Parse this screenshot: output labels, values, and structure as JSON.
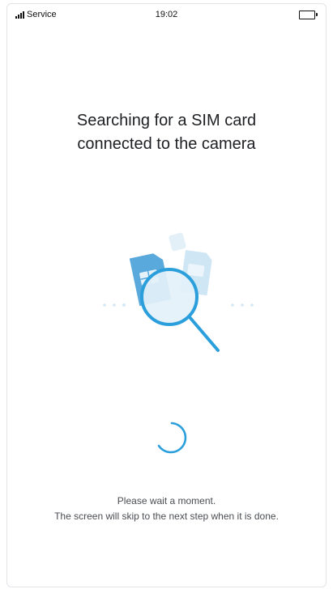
{
  "status_bar": {
    "carrier": "Service",
    "time": "19:02",
    "battery_icon": "battery-icon",
    "signal_icon": "signal-icon"
  },
  "main": {
    "title_line1": "Searching for a SIM card",
    "title_line2": "connected to the camera",
    "illustration_icon": "magnifier-over-sim-cards-icon",
    "spinner_icon": "loading-spinner-icon",
    "wait_message": "Please wait a moment.",
    "skip_message": "The screen will skip to the next step when it is done."
  },
  "colors": {
    "accent": "#2a9fdc",
    "accent_light": "#cfe8f6",
    "title_text": "#1d1f22",
    "body_text": "#4a4d52"
  }
}
